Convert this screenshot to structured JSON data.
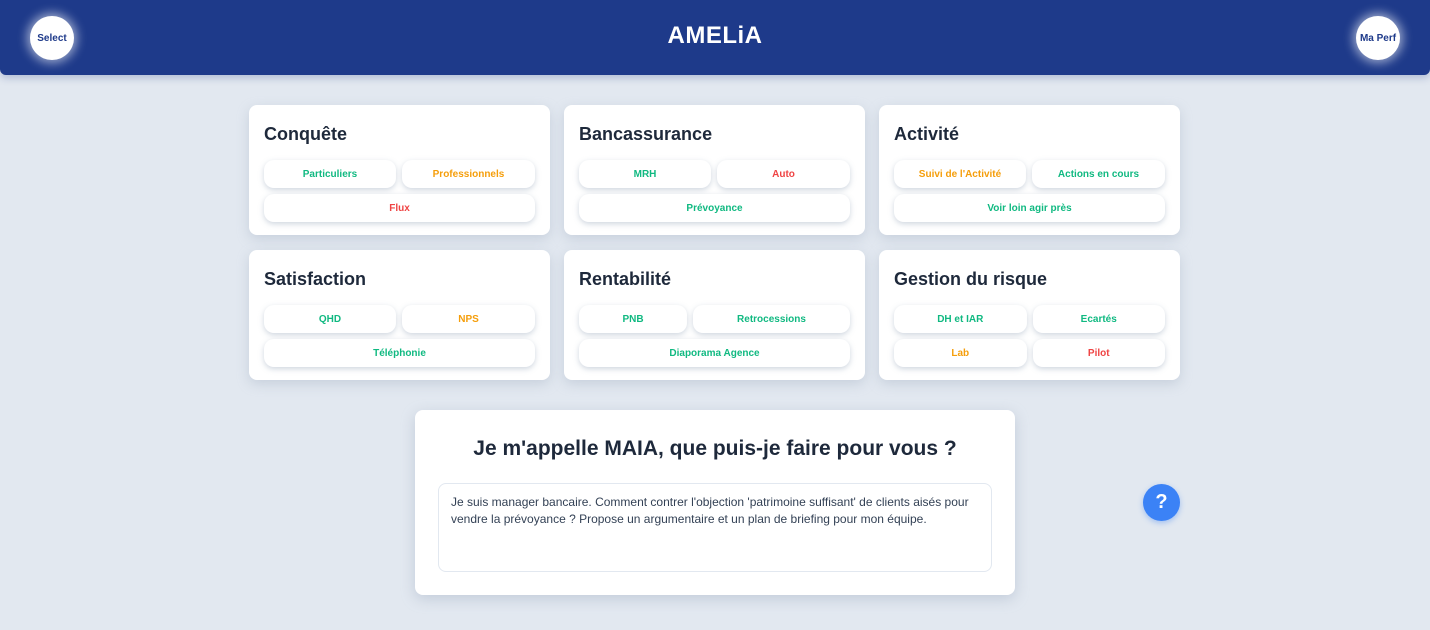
{
  "header": {
    "title": "AMELiA",
    "left_button": "Select",
    "right_button": "Ma Perf",
    "background": "#1e3a8a"
  },
  "cards": [
    {
      "title": "Conquête",
      "rows": [
        [
          {
            "label": "Particuliers",
            "color": "green"
          },
          {
            "label": "Professionnels",
            "color": "orange"
          }
        ],
        [
          {
            "label": "Flux",
            "color": "red"
          }
        ]
      ]
    },
    {
      "title": "Bancassurance",
      "rows": [
        [
          {
            "label": "MRH",
            "color": "green"
          },
          {
            "label": "Auto",
            "color": "red"
          }
        ],
        [
          {
            "label": "Prévoyance",
            "color": "green"
          }
        ]
      ]
    },
    {
      "title": "Activité",
      "rows": [
        [
          {
            "label": "Suivi de l'Activité",
            "color": "orange"
          },
          {
            "label": "Actions en cours",
            "color": "green"
          }
        ],
        [
          {
            "label": "Voir loin agir près",
            "color": "green"
          }
        ]
      ]
    },
    {
      "title": "Satisfaction",
      "rows": [
        [
          {
            "label": "QHD",
            "color": "green"
          },
          {
            "label": "NPS",
            "color": "orange"
          }
        ],
        [
          {
            "label": "Téléphonie",
            "color": "green"
          }
        ]
      ]
    },
    {
      "title": "Rentabilité",
      "rows": [
        [
          {
            "label": "PNB",
            "color": "green"
          },
          {
            "label": "Retrocessions",
            "color": "green"
          }
        ],
        [
          {
            "label": "Diaporama Agence",
            "color": "green"
          }
        ]
      ]
    },
    {
      "title": "Gestion du risque",
      "rows": [
        [
          {
            "label": "DH et IAR",
            "color": "green"
          },
          {
            "label": "Ecartés",
            "color": "green"
          }
        ],
        [
          {
            "label": "Lab",
            "color": "orange"
          },
          {
            "label": "Pilot",
            "color": "red"
          }
        ]
      ]
    }
  ],
  "chat": {
    "title": "Je m'appelle MAIA, que puis-je faire pour vous ?",
    "input_value": "Je suis manager bancaire. Comment contrer l'objection 'patrimoine suffisant' de clients aisés pour vendre la prévoyance ? Propose un argumentaire et un plan de briefing pour mon équipe."
  },
  "help_button": "?",
  "colors": {
    "green": "#10b981",
    "orange": "#f59e0b",
    "red": "#ef4444",
    "page_background": "#e2e8f0",
    "help": "#3b82f6"
  }
}
